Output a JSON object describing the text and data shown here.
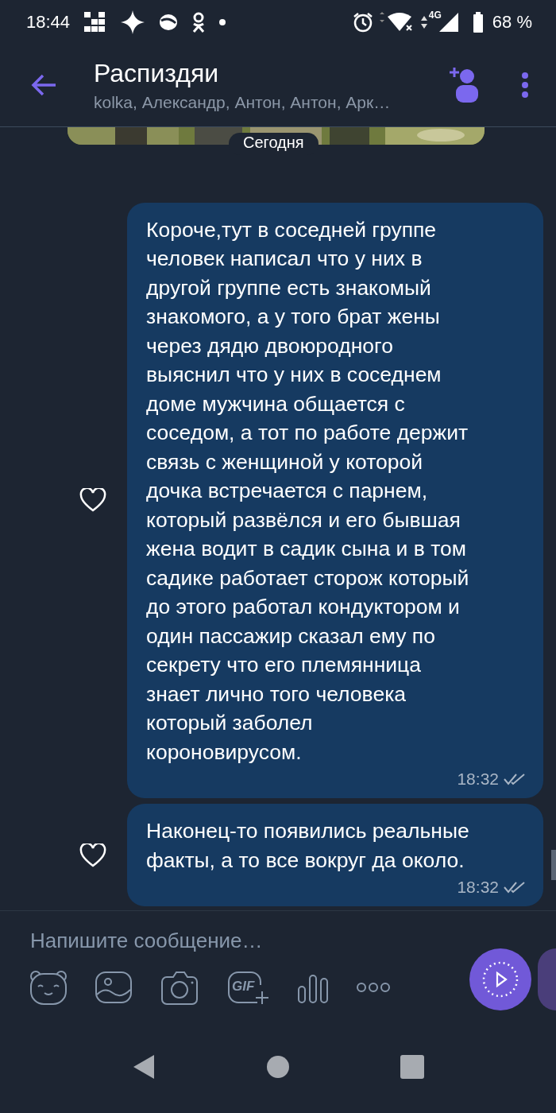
{
  "status_bar": {
    "time": "18:44",
    "battery": "68 %",
    "network": "4G"
  },
  "header": {
    "title": "Распиздяи",
    "subtitle": "kolka, Александр, Антон, Антон, Арк…"
  },
  "date_label": "Сегодня",
  "messages": [
    {
      "text": "Короче,тут в соседней группе человек написал что у них в другой группе есть знакомый знакомого, а у того брат жены через дядю двоюродного выяснил что у них в соседнем доме мужчина общается с соседом, а тот по работе держит связь с женщиной у которой дочка встречается с парнем, который развёлся и его бывшая жена водит в садик сына и в том садике работает сторож который до этого работал кондуктором и один пассажир сказал ему по секрету что его племянница знает лично того человека который заболел короновирусом.",
      "time": "18:32"
    },
    {
      "text": "Наконец-то появились реальные факты, а то все вокруг да около.",
      "time": "18:32"
    }
  ],
  "composer": {
    "placeholder": "Напишите сообщение…",
    "gif_label": "GIF"
  }
}
